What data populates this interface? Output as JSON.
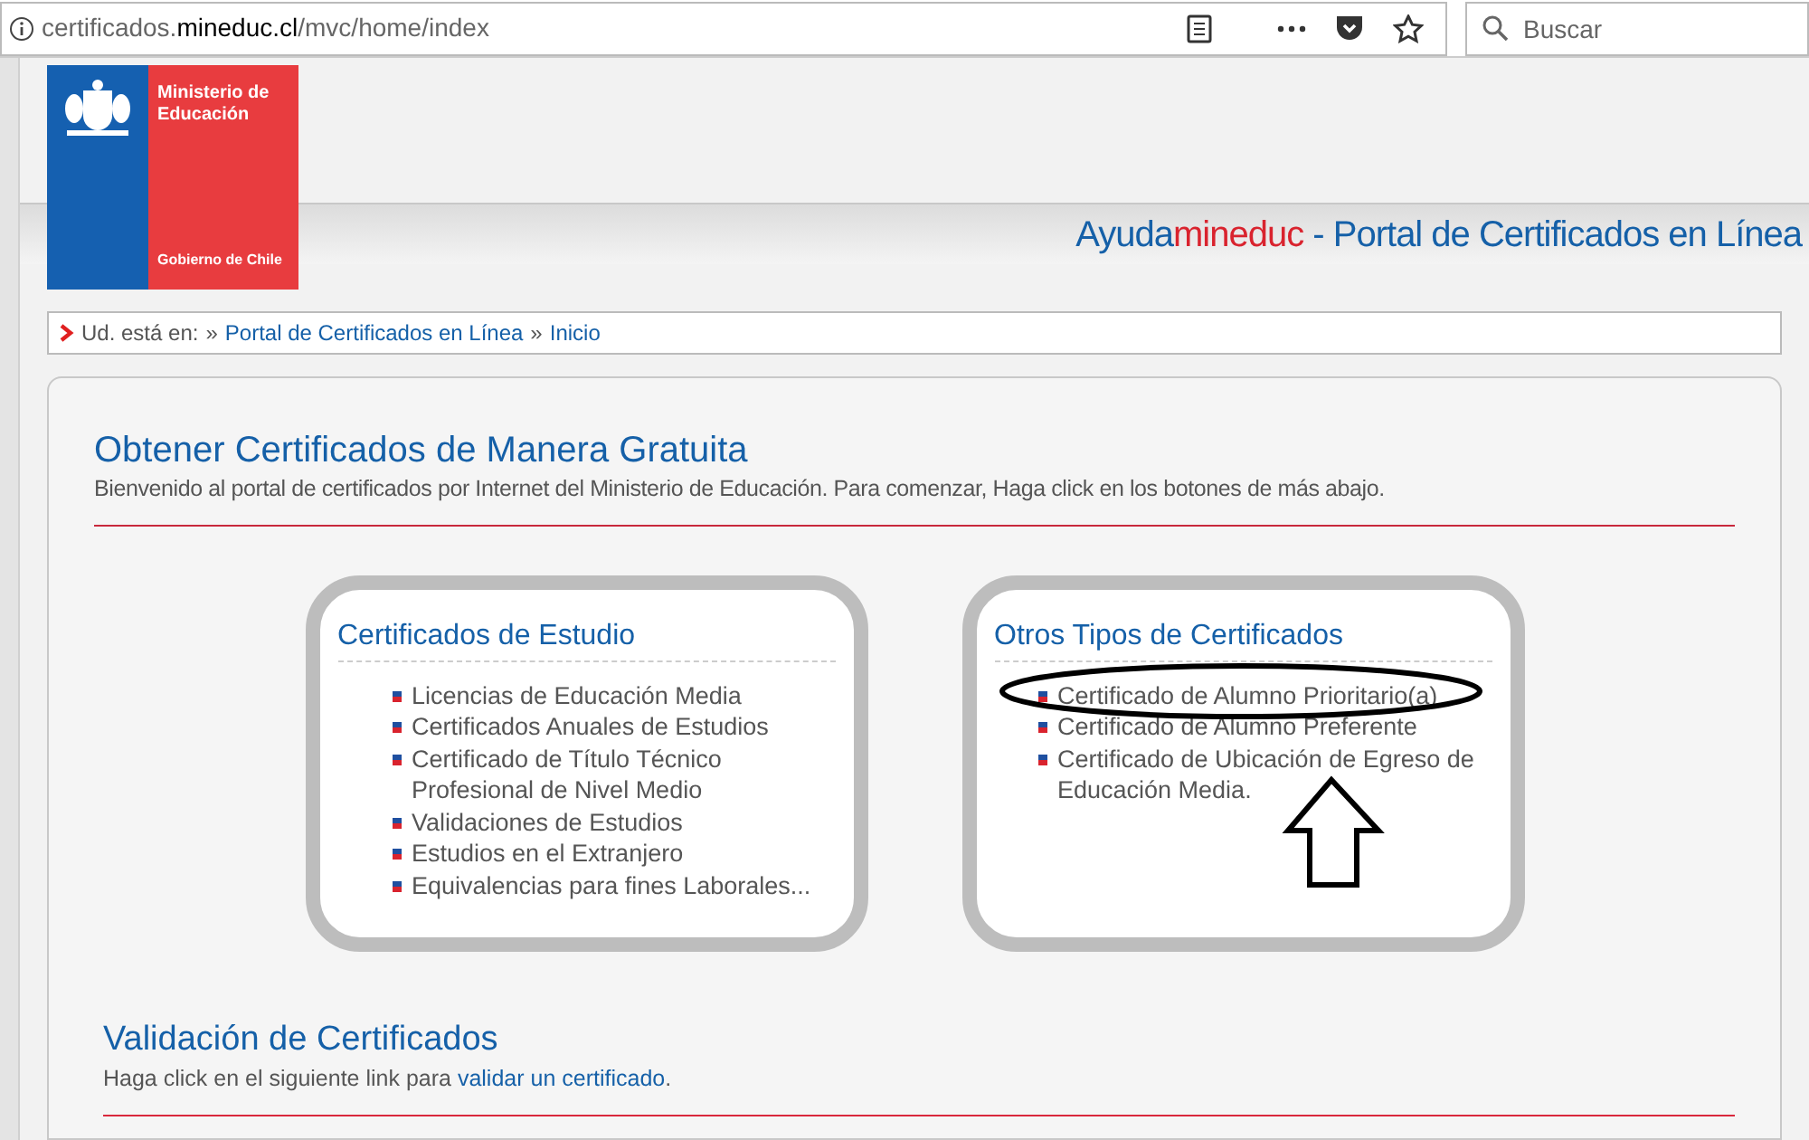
{
  "browser": {
    "url": "certificados.**mineduc.cl**/mvc/home/index",
    "search": {
      "placeholder": "Buscar"
    }
  },
  "logo": {
    "ministry": "Ministerio de Educación",
    "government": "Gobierno de Chile"
  },
  "banner": {
    "brand_prefix": "Ayuda",
    "brand_highlight": "mineduc",
    "title": " - Portal de Certificados en Línea"
  },
  "breadcrumb": {
    "label": "Ud. está en:",
    "items": [
      {
        "separator": "»",
        "text": "Portal de Certificados en Línea"
      },
      {
        "separator": "»",
        "text": "Inicio"
      }
    ]
  },
  "intro": {
    "heading": "Obtener Certificados de Manera Gratuita",
    "text": "Bienvenido al portal de certificados por Internet del Ministerio de Educación. Para comenzar, Haga click en los botones de más abajo."
  },
  "cards": [
    {
      "title": "Certificados de Estudio",
      "items": [
        "Licencias de Educación Media",
        "Certificados Anuales de Estudios",
        "Certificado de Título Técnico Profesional de Nivel Medio",
        "Validaciones de Estudios",
        "Estudios en el Extranjero",
        "Equivalencias para fines Laborales..."
      ],
      "annotated": false
    },
    {
      "title": "Otros Tipos de Certificados",
      "items": [
        "Certificado de Alumno Prioritario(a)",
        "Certificado de Alumno Preferente",
        "Certificado de Ubicación de Egreso de Educación Media."
      ],
      "annotated": true
    }
  ],
  "validation": {
    "heading": "Validación de Certificados",
    "text": "Haga click en el siguiente link para ",
    "link": "validar un certificado",
    "after": "."
  }
}
